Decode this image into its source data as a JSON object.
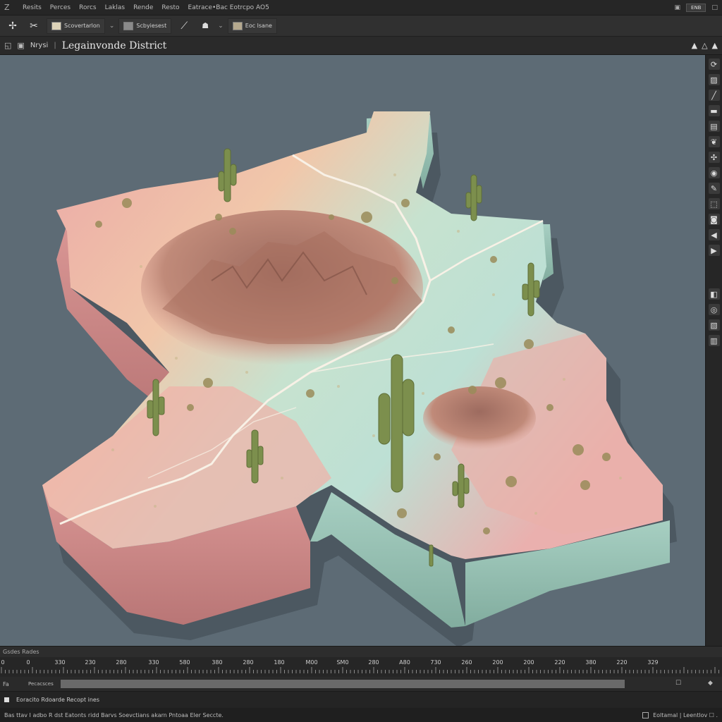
{
  "menubar": {
    "app_icon": "z-app-icon",
    "items": [
      "Resits",
      "Perces",
      "Rorcs",
      "Laklas",
      "Rende",
      "Resto",
      "Eatrace•Bac Eotrcpo AO5"
    ],
    "window_buttons": [
      "▣",
      "ENB",
      "□"
    ]
  },
  "toolbar": {
    "tool1_icon": "node-tool-icon",
    "tool2_icon": "scissor-tool-icon",
    "group1_label": "Scovertarlon",
    "group2_label": "Scbyiesest",
    "group3_label": "Eoc lsane"
  },
  "doc_tabs": {
    "tab_label": "Nrysi",
    "doc_title": "Legainvonde District",
    "right_icons": [
      "▲",
      "△",
      "▲"
    ]
  },
  "right_strip": {
    "icons": [
      "refresh-icon",
      "brush-icon",
      "line-icon",
      "square-icon",
      "layer-icon",
      "leaf-icon",
      "gear-icon",
      "eye-icon",
      "pencil-icon",
      "shape-icon",
      "camera-icon",
      "play-left-icon",
      "play-icon",
      "lock-icon",
      "target-icon",
      "pattern-icon",
      "stack-icon"
    ]
  },
  "timeline": {
    "header": "Gsdes  Rades",
    "ruler_labels": [
      "0",
      "0",
      "330",
      "230",
      "280",
      "330",
      "580",
      "380",
      "280",
      "180",
      "M00",
      "SM0",
      "280",
      "A80",
      "730",
      "260",
      "200",
      "200",
      "220",
      "380",
      "220",
      "329"
    ],
    "track_tag": "Fa",
    "track_name": "Pecacsces",
    "track_end_icon": "☐",
    "track_end2_icon": "◆"
  },
  "status": {
    "line1": "Eoracito Rdoarde Recopt ines",
    "line2": "Bas  ttav I adbo  R  dst Eatonts ridd  Barvs  Soevctians  akarn  Pntoaa  Eler  Seccte.",
    "line2_right": "Eoltamal | Leentlov ☐ ."
  },
  "map": {
    "colors": {
      "pink": "#e8a4a4",
      "peach": "#f0cba6",
      "mint": "#b9ddcf",
      "mountain": "#b27c6a",
      "background": "#5d6b75",
      "cactus": "#7c8f4d"
    }
  }
}
